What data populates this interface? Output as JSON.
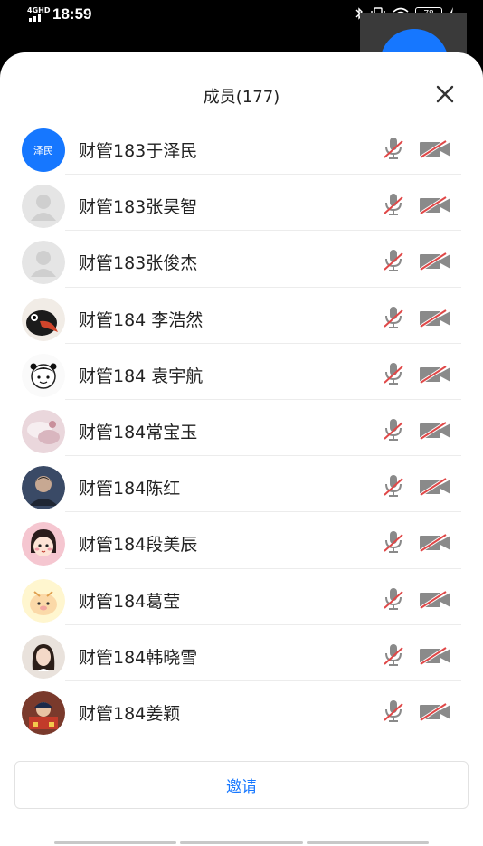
{
  "status_bar": {
    "network": "4GHD",
    "time": "18:59",
    "battery": "78"
  },
  "sheet": {
    "title": "成员(177)",
    "close_icon": "close-icon",
    "invite_label": "邀请"
  },
  "members": [
    {
      "name": "财管183于泽民",
      "avatar_text": "泽民",
      "avatar": "text"
    },
    {
      "name": "财管183张昊智",
      "avatar": "default"
    },
    {
      "name": "财管183张俊杰",
      "avatar": "default"
    },
    {
      "name": "财管184 李浩然",
      "avatar": "bird"
    },
    {
      "name": "财管184 袁宇航",
      "avatar": "cartoon-girl"
    },
    {
      "name": "财管184常宝玉",
      "avatar": "pink-photo"
    },
    {
      "name": "财管184陈红",
      "avatar": "dark-photo"
    },
    {
      "name": "财管184段美辰",
      "avatar": "pink-cartoon"
    },
    {
      "name": "财管184葛莹",
      "avatar": "yellow-cartoon"
    },
    {
      "name": "财管184韩晓雪",
      "avatar": "girl-photo"
    },
    {
      "name": "财管184姜颖",
      "avatar": "red-photo"
    }
  ],
  "colors": {
    "accent": "#1677ff",
    "muted_icon": "#8a8a8a",
    "muted_slash": "#e04848"
  }
}
